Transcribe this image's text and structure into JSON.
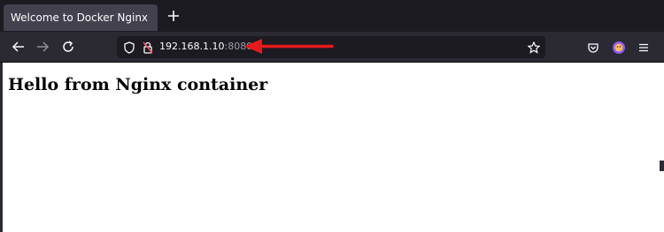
{
  "tab": {
    "title": "Welcome to Docker Nginx"
  },
  "address_bar": {
    "host": "192.168.1.10",
    "port": ":8080"
  },
  "page": {
    "heading": "Hello from Nginx container"
  },
  "icons": {
    "new_tab": "plus-icon",
    "back": "back-arrow-icon",
    "forward": "forward-arrow-icon",
    "reload": "reload-icon",
    "tracking_protection": "shield-icon",
    "connection": "insecure-lock-icon",
    "bookmark": "star-icon",
    "pocket": "pocket-icon",
    "account": "account-avatar-icon",
    "menu": "hamburger-menu-icon"
  },
  "annotation": {
    "arrow_color": "#e8191b"
  }
}
